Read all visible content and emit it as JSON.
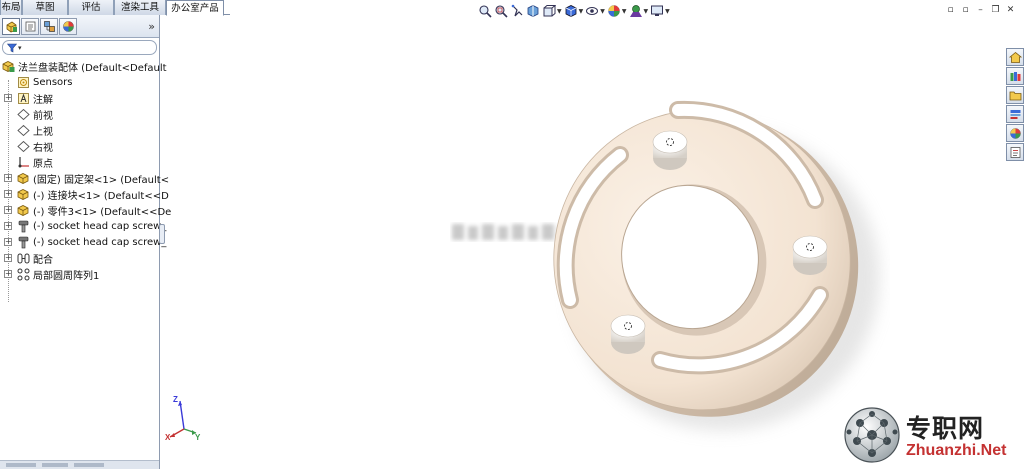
{
  "command_tabs": [
    "布局",
    "草图",
    "评估",
    "渲染工具",
    "办公室产品"
  ],
  "active_command_tab": "办公室产品",
  "panel_tabs": [
    {
      "icon": "feature-manager-icon"
    },
    {
      "icon": "property-manager-icon"
    },
    {
      "icon": "configuration-manager-icon"
    },
    {
      "icon": "display-manager-icon"
    }
  ],
  "panel_expand_glyph": "»",
  "filter": {
    "icon": "filter-icon",
    "arrow": "▾"
  },
  "tree": {
    "root": "法兰盘装配体  (Default<Default",
    "items": [
      {
        "label": "Sensors",
        "icon": "sensors-icon",
        "expand": ""
      },
      {
        "label": "注解",
        "icon": "annotations-icon",
        "expand": "+"
      },
      {
        "label": "前视",
        "icon": "plane-icon",
        "expand": ""
      },
      {
        "label": "上视",
        "icon": "plane-icon",
        "expand": ""
      },
      {
        "label": "右视",
        "icon": "plane-icon",
        "expand": ""
      },
      {
        "label": "原点",
        "icon": "origin-icon",
        "expand": ""
      },
      {
        "label": "(固定) 固定架<1> (Default<",
        "icon": "part-icon",
        "expand": "+"
      },
      {
        "label": "(-) 连接块<1> (Default<<D",
        "icon": "part-icon",
        "expand": "+"
      },
      {
        "label": "(-) 零件3<1> (Default<<De",
        "icon": "part-icon",
        "expand": "+"
      },
      {
        "label": "(-) socket head cap screw_",
        "icon": "screw-icon",
        "expand": "+"
      },
      {
        "label": "(-) socket head cap screw_",
        "icon": "screw-icon",
        "expand": "+"
      },
      {
        "label": "配合",
        "icon": "mates-icon",
        "expand": "+"
      },
      {
        "label": "局部圆周阵列1",
        "icon": "pattern-icon",
        "expand": "+"
      }
    ]
  },
  "hud_tools": [
    "zoom-to-fit-icon",
    "zoom-to-area-icon",
    "previous-view-icon",
    "section-view-icon",
    "view-orientation-icon",
    "display-style-icon",
    "hide-show-items-icon",
    "edit-appearance-icon",
    "apply-scene-icon",
    "view-settings-icon"
  ],
  "window_controls": [
    "▫",
    "▫",
    "–",
    "❐",
    "✕"
  ],
  "task_pane": [
    "solidworks-resources-icon",
    "design-library-icon",
    "file-explorer-icon",
    "view-palette-icon",
    "appearances-icon",
    "custom-properties-icon"
  ],
  "triad": {
    "x": "X",
    "y": "Y",
    "z": "Z"
  },
  "logo": {
    "cn": "专职网",
    "en": "Zhuanzhi.Net"
  },
  "colors": {
    "part": "#f4e6d8",
    "accent": "#c43232",
    "panel_border": "#8e9bb0"
  }
}
